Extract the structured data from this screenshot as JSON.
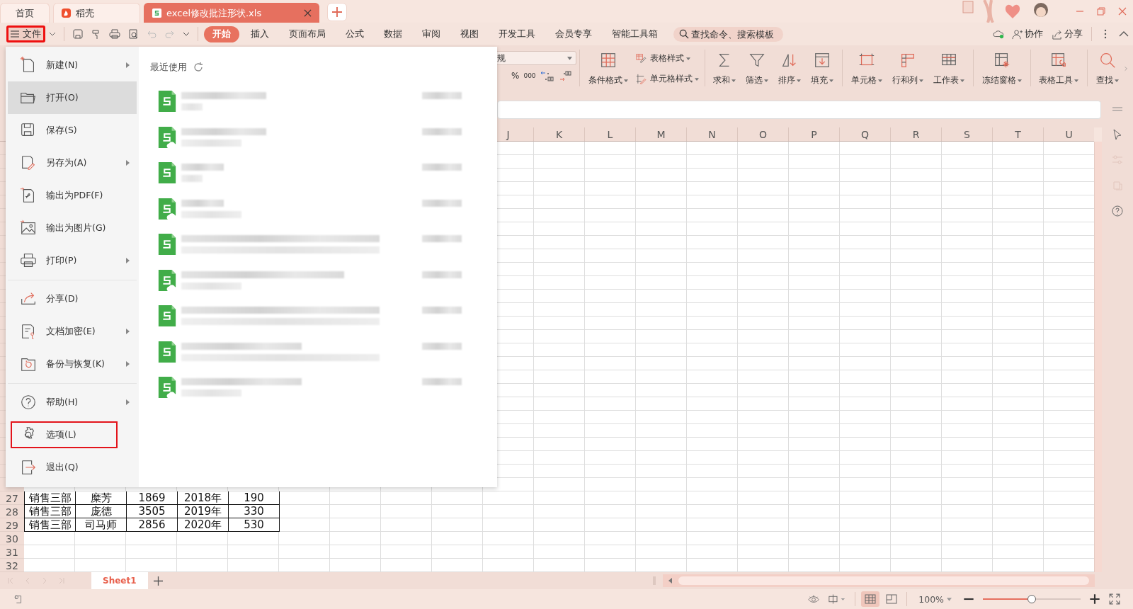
{
  "title_bar": {
    "tabs": [
      {
        "label": "首页",
        "kind": "home",
        "selected": false
      },
      {
        "label": "稻壳",
        "kind": "docer",
        "selected": false
      },
      {
        "label": "excel修改批注形状.xls",
        "kind": "document",
        "selected": true
      }
    ]
  },
  "menu_bar": {
    "file_button": {
      "label": "文件",
      "highlighted": true
    },
    "tabs": [
      {
        "label": "开始",
        "selected": true
      },
      {
        "label": "插入",
        "selected": false
      },
      {
        "label": "页面布局",
        "selected": false
      },
      {
        "label": "公式",
        "selected": false
      },
      {
        "label": "数据",
        "selected": false
      },
      {
        "label": "审阅",
        "selected": false
      },
      {
        "label": "视图",
        "selected": false
      },
      {
        "label": "开发工具",
        "selected": false
      },
      {
        "label": "会员专享",
        "selected": false
      },
      {
        "label": "智能工具箱",
        "selected": false
      }
    ],
    "search": {
      "placeholder": "查找命令、搜索模板"
    },
    "actions": [
      {
        "label": "协作"
      },
      {
        "label": "分享"
      }
    ]
  },
  "ribbon": {
    "number_format": {
      "value": "规"
    },
    "number_buttons": [
      "%",
      "000"
    ],
    "groups": [
      [
        {
          "label": "条件格式",
          "kind": "large",
          "caret": true
        },
        {
          "label": "表格样式",
          "kind": "small",
          "caret": true
        },
        {
          "label": "单元格样式",
          "kind": "small",
          "caret": true
        }
      ],
      [
        {
          "label": "求和",
          "kind": "large",
          "caret": true
        },
        {
          "label": "筛选",
          "kind": "large",
          "caret": true
        },
        {
          "label": "排序",
          "kind": "large",
          "caret": true
        },
        {
          "label": "填充",
          "kind": "large",
          "caret": true
        }
      ],
      [
        {
          "label": "单元格",
          "kind": "large",
          "caret": true
        },
        {
          "label": "行和列",
          "kind": "large",
          "caret": true
        },
        {
          "label": "工作表",
          "kind": "large",
          "caret": true
        }
      ],
      [
        {
          "label": "冻结窗格",
          "kind": "large",
          "caret": true
        }
      ],
      [
        {
          "label": "表格工具",
          "kind": "large",
          "caret": true
        }
      ],
      [
        {
          "label": "查找",
          "kind": "large",
          "caret": true
        }
      ]
    ]
  },
  "file_menu": {
    "items": [
      {
        "label": "新建(N)",
        "submenu": true,
        "selected": false,
        "highlighted": false,
        "divider_before": false
      },
      {
        "label": "打开(O)",
        "submenu": false,
        "selected": true,
        "highlighted": false,
        "divider_before": false
      },
      {
        "label": "保存(S)",
        "submenu": false,
        "selected": false,
        "highlighted": false,
        "divider_before": false
      },
      {
        "label": "另存为(A)",
        "submenu": true,
        "selected": false,
        "highlighted": false,
        "divider_before": false
      },
      {
        "label": "输出为PDF(F)",
        "submenu": false,
        "selected": false,
        "highlighted": false,
        "divider_before": false
      },
      {
        "label": "输出为图片(G)",
        "submenu": false,
        "selected": false,
        "highlighted": false,
        "divider_before": false
      },
      {
        "label": "打印(P)",
        "submenu": true,
        "selected": false,
        "highlighted": false,
        "divider_before": false
      },
      {
        "label": "分享(D)",
        "submenu": false,
        "selected": false,
        "highlighted": false,
        "divider_before": true
      },
      {
        "label": "文档加密(E)",
        "submenu": true,
        "selected": false,
        "highlighted": false,
        "divider_before": false
      },
      {
        "label": "备份与恢复(K)",
        "submenu": true,
        "selected": false,
        "highlighted": false,
        "divider_before": false
      },
      {
        "label": "帮助(H)",
        "submenu": true,
        "selected": false,
        "highlighted": false,
        "divider_before": true
      },
      {
        "label": "选项(L)",
        "submenu": false,
        "selected": false,
        "highlighted": true,
        "divider_before": false
      },
      {
        "label": "退出(Q)",
        "submenu": false,
        "selected": false,
        "highlighted": false,
        "divider_before": false
      }
    ],
    "recent": {
      "title": "最近使用",
      "files": [
        {
          "cloud": false
        },
        {
          "cloud": true
        },
        {
          "cloud": false
        },
        {
          "cloud": true
        },
        {
          "cloud": false
        },
        {
          "cloud": true
        },
        {
          "cloud": false
        },
        {
          "cloud": false
        },
        {
          "cloud": true
        }
      ]
    }
  },
  "sheet": {
    "columns": [
      "J",
      "K",
      "L",
      "M",
      "N",
      "O",
      "P",
      "Q",
      "R",
      "S",
      "T",
      "U"
    ],
    "rows": [
      {
        "number": "27",
        "cells": [
          "销售三部",
          "糜芳",
          "1869",
          "2018年",
          "190"
        ]
      },
      {
        "number": "28",
        "cells": [
          "销售三部",
          "庞德",
          "3505",
          "2019年",
          "330"
        ]
      },
      {
        "number": "29",
        "cells": [
          "销售三部",
          "司马师",
          "2856",
          "2020年",
          "530"
        ]
      },
      {
        "number": "30"
      },
      {
        "number": "31"
      },
      {
        "number": "32"
      }
    ]
  },
  "sheet_tabs": {
    "tabs": [
      {
        "label": "Sheet1",
        "selected": true
      }
    ]
  },
  "status_bar": {
    "view_modes": [
      {
        "selected": true
      },
      {
        "selected": false
      }
    ],
    "zoom": "100%",
    "zoom_slider": {
      "level": 0.5
    }
  }
}
